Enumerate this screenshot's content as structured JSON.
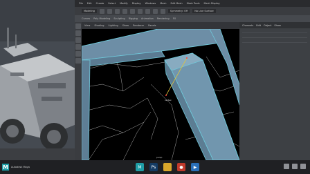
{
  "window": {
    "app_name": "Autodesk Maya"
  },
  "menubar": {
    "items": [
      "File",
      "Edit",
      "Create",
      "Select",
      "Modify",
      "Display",
      "Windows",
      "Mesh",
      "Edit Mesh",
      "Mesh Tools",
      "Mesh Display"
    ]
  },
  "toolbar": {
    "mode_field": "Modeling",
    "status_label": "Symmetry: Off",
    "stats_label": "No Live Surface"
  },
  "shelf": {
    "tabs": [
      "Curves",
      "Poly Modeling",
      "Sculpting",
      "Rigging",
      "Animation",
      "Rendering",
      "FX"
    ]
  },
  "viewport": {
    "menus": [
      "View",
      "Shading",
      "Lighting",
      "Show",
      "Renderer",
      "Panels"
    ],
    "camera_label": "persp",
    "cursor_label": "vertex"
  },
  "rightpanel": {
    "tabs": [
      "Channels",
      "Edit",
      "Object",
      "Show"
    ]
  },
  "taskbar": {
    "app_label": "Autodesk Maya",
    "icons": [
      "maya-icon",
      "photoshop-icon",
      "folder-icon",
      "media-icon",
      "recorder-icon"
    ]
  },
  "colors": {
    "accent": "#1f9ea6",
    "mesh_highlight": "#6fc7d9",
    "mesh_face": "#6d8ea6"
  }
}
